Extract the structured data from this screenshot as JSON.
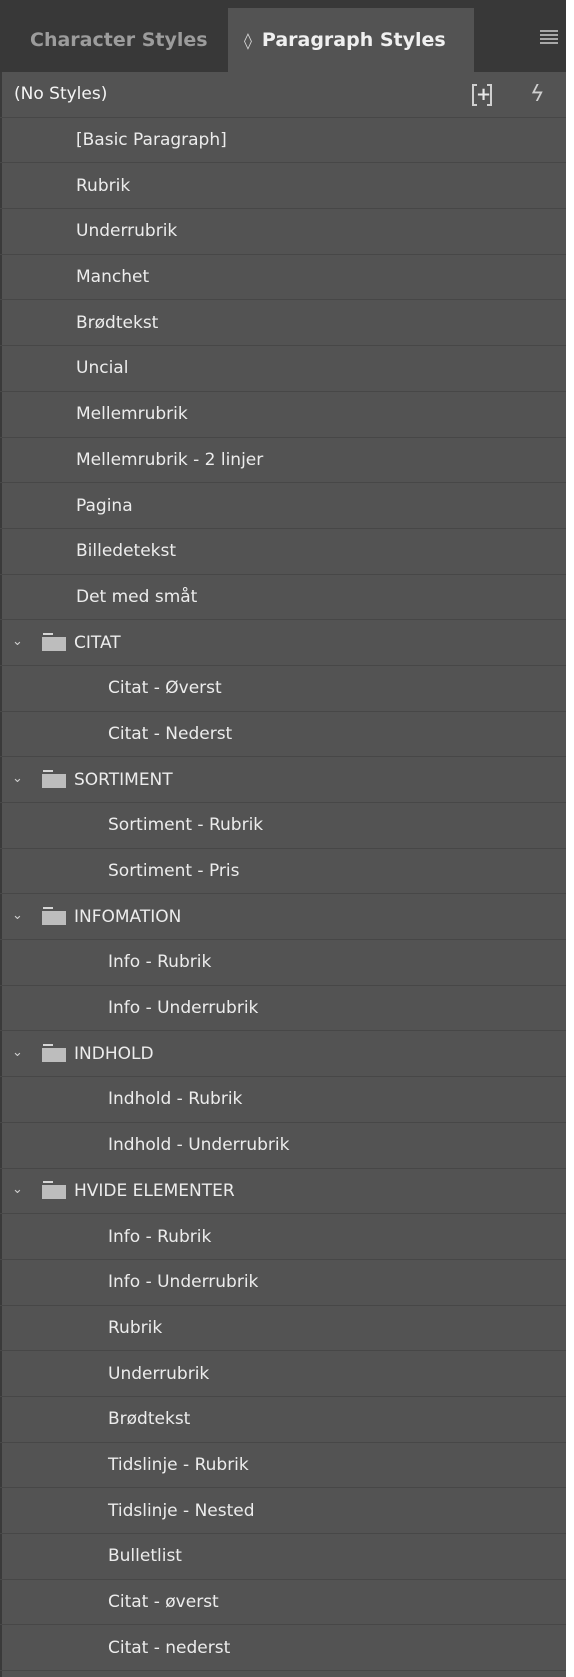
{
  "tabs": {
    "character": "Character Styles",
    "paragraph": "Paragraph Styles",
    "paragraph_glyph": "◊"
  },
  "header_row": {
    "label": "(No Styles)",
    "new_group_icon": "new-style-group-icon",
    "quick_apply_icon": "lightning-bolt-icon"
  },
  "styles": [
    "[Basic Paragraph]",
    "Rubrik",
    "Underrubrik",
    "Manchet",
    "Brødtekst",
    "Uncial",
    "Mellemrubrik",
    "Mellemrubrik - 2 linjer",
    "Pagina",
    "Billedetekst",
    "Det med småt"
  ],
  "groups": [
    {
      "name": "CITAT",
      "items": [
        "Citat - Øverst",
        "Citat - Nederst"
      ]
    },
    {
      "name": "SORTIMENT",
      "items": [
        "Sortiment - Rubrik",
        "Sortiment - Pris"
      ]
    },
    {
      "name": "INFOMATION",
      "items": [
        "Info - Rubrik",
        "Info - Underrubrik"
      ]
    },
    {
      "name": "INDHOLD",
      "items": [
        "Indhold - Rubrik",
        "Indhold - Underrubrik"
      ]
    },
    {
      "name": "HVIDE ELEMENTER",
      "items": [
        "Info - Rubrik",
        "Info - Underrubrik",
        "Rubrik",
        "Underrubrik",
        "Brødtekst",
        "Tidslinje - Rubrik",
        "Tidslinje - Nested",
        "Bulletlist",
        "Citat - øverst",
        "Citat - nederst"
      ]
    }
  ],
  "colors": {
    "panel_bg": "#535353",
    "tabbar_bg": "#383838",
    "text": "#ececec"
  }
}
